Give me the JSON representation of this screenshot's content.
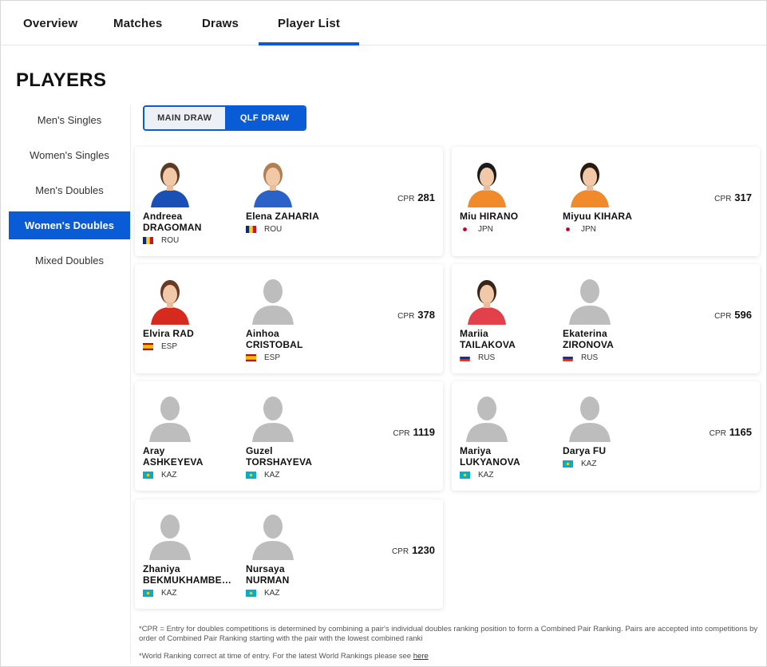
{
  "tabs": [
    "Overview",
    "Matches",
    "Draws",
    "Player List"
  ],
  "page_title": "PLAYERS",
  "sidebar": [
    "Men's Singles",
    "Women's Singles",
    "Men's Doubles",
    "Women's Doubles",
    "Mixed Doubles"
  ],
  "sidebar_active": "Women's Doubles",
  "draw_toggle": {
    "main": "MAIN DRAW",
    "qlf": "QLF DRAW",
    "active": "QLF DRAW"
  },
  "cpr_label": "CPR",
  "pairs": [
    {
      "cpr": "281",
      "players": [
        {
          "first": "Andreea",
          "last": "DRAGOMAN",
          "country": "ROU",
          "photo": true
        },
        {
          "first": "Elena ZAHARIA",
          "last": "",
          "country": "ROU",
          "photo": true
        }
      ]
    },
    {
      "cpr": "317",
      "players": [
        {
          "first": "Miu HIRANO",
          "last": "",
          "country": "JPN",
          "photo": true
        },
        {
          "first": "Miyuu KIHARA",
          "last": "",
          "country": "JPN",
          "photo": true
        }
      ]
    },
    {
      "cpr": "378",
      "players": [
        {
          "first": "Elvira RAD",
          "last": "",
          "country": "ESP",
          "photo": true
        },
        {
          "first": "Ainhoa",
          "last": "CRISTOBAL",
          "country": "ESP",
          "photo": false
        }
      ]
    },
    {
      "cpr": "596",
      "players": [
        {
          "first": "Mariia",
          "last": "TAILAKOVA",
          "country": "RUS",
          "photo": true
        },
        {
          "first": "Ekaterina",
          "last": "ZIRONOVA",
          "country": "RUS",
          "photo": false
        }
      ]
    },
    {
      "cpr": "1119",
      "players": [
        {
          "first": "Aray",
          "last": "ASHKEYEVA",
          "country": "KAZ",
          "photo": false
        },
        {
          "first": "Guzel",
          "last": "TORSHAYEVA",
          "country": "KAZ",
          "photo": false
        }
      ]
    },
    {
      "cpr": "1165",
      "players": [
        {
          "first": "Mariya",
          "last": "LUKYANOVA",
          "country": "KAZ",
          "photo": false
        },
        {
          "first": "Darya FU",
          "last": "",
          "country": "KAZ",
          "photo": false
        }
      ]
    },
    {
      "cpr": "1230",
      "players": [
        {
          "first": "Zhaniya",
          "last": "BEKMUKHAMBETOVA",
          "country": "KAZ",
          "photo": false
        },
        {
          "first": "Nursaya",
          "last": "NURMAN",
          "country": "KAZ",
          "photo": false
        }
      ]
    }
  ],
  "footnotes": {
    "cpr_note": "*CPR = Entry for doubles competitions is determined by combining a pair's individual doubles ranking position to form a Combined Pair Ranking. Pairs are accepted into competitions by order of Combined Pair Ranking starting with the pair with the lowest combined ranki",
    "ranking_note": "*World Ranking correct at time of entry. For the latest World Rankings please see",
    "ranking_link": "here"
  },
  "colors": {
    "accent": "#0a5bd6",
    "toggle_off": "#edf0f4"
  }
}
